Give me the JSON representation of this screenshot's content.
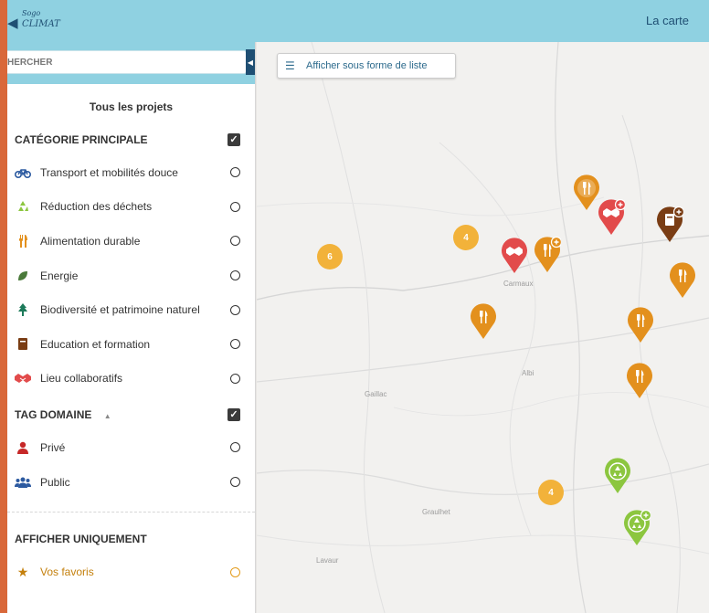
{
  "header": {
    "logo_top": "Sogo",
    "logo_bottom": "CLIMAT",
    "nav_title": "La carte"
  },
  "sidebar": {
    "search": {
      "value": "HERCHER",
      "placeholder": "HERCHER"
    },
    "all_projects": "Tous les projets",
    "category_section": {
      "title": "CATÉGORIE PRINCIPALE",
      "items": [
        {
          "label": "Transport et mobilités douce",
          "icon": "bicycle-icon"
        },
        {
          "label": "Réduction des déchets",
          "icon": "recycle-icon"
        },
        {
          "label": "Alimentation durable",
          "icon": "fork-knife-icon"
        },
        {
          "label": "Energie",
          "icon": "leaf-icon"
        },
        {
          "label": "Biodiversité et patrimoine naturel",
          "icon": "tree-icon"
        },
        {
          "label": "Education et formation",
          "icon": "book-icon"
        },
        {
          "label": "Lieu collaboratifs",
          "icon": "handshake-icon"
        }
      ]
    },
    "tag_section": {
      "title": "TAG DOMAINE",
      "items": [
        {
          "label": "Privé",
          "icon": "person-icon"
        },
        {
          "label": "Public",
          "icon": "group-icon"
        }
      ]
    },
    "show_only": {
      "title": "AFFICHER UNIQUEMENT",
      "favorites_label": "Vos favoris"
    }
  },
  "map": {
    "list_button_label": "Afficher sous forme de liste",
    "places": [
      "Carmaux",
      "Albi",
      "Gaillac",
      "Graulhet",
      "Lavaur"
    ],
    "clusters": [
      "6",
      "4",
      "4"
    ]
  },
  "colors": {
    "header": "#8fd1e1",
    "food": "#e3901d",
    "collab": "#e24b4b",
    "education": "#7a3d14",
    "waste": "#8cc63f",
    "cluster": "#f2b23a"
  }
}
